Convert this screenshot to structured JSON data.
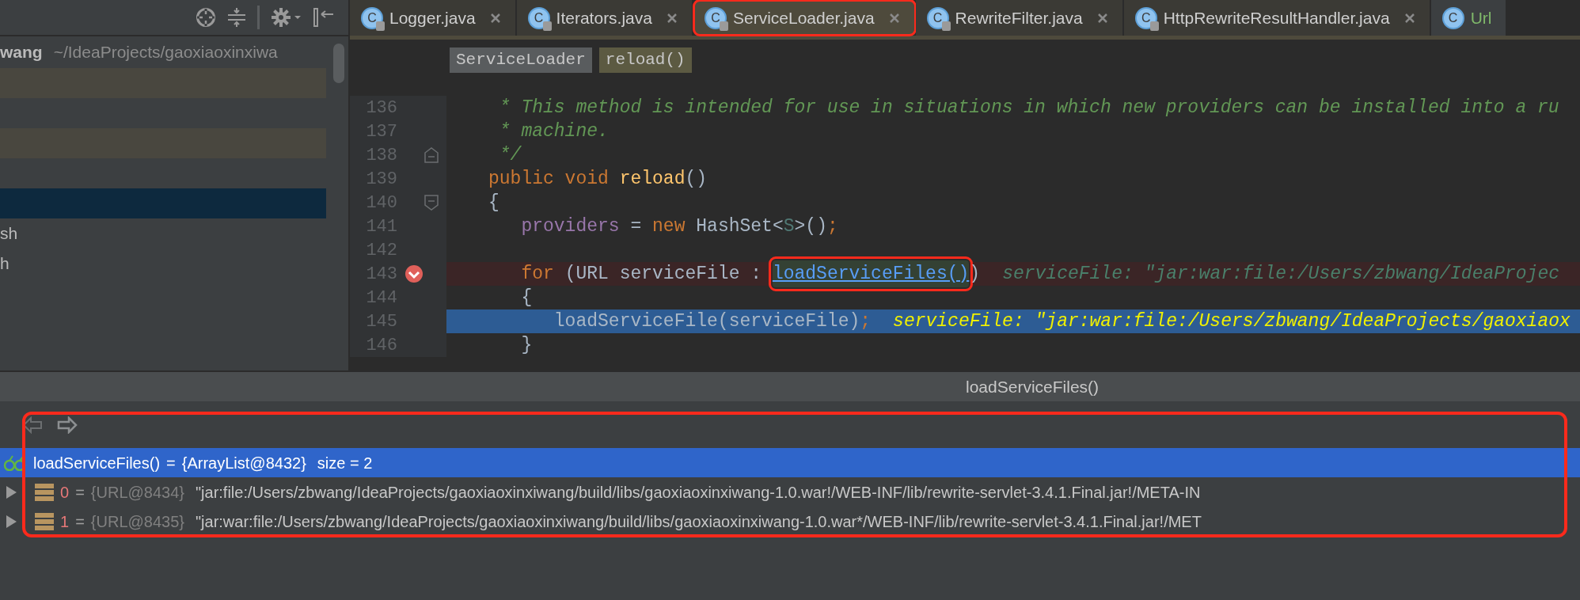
{
  "project_panel": {
    "root": {
      "name": "wang",
      "path": "~/IdeaProjects/gaoxiaoxinxiwa"
    },
    "rows": [
      {
        "highlighted": true,
        "selected": false
      },
      {
        "highlighted": true,
        "selected": false
      },
      {
        "highlighted": false,
        "selected": true
      },
      {
        "label": "sh",
        "highlighted": false,
        "selected": false
      },
      {
        "label": "h",
        "highlighted": false,
        "selected": false
      }
    ]
  },
  "editor_tabs": [
    {
      "label": "Logger.java",
      "icon_letter": "C",
      "selected": false,
      "locked": true,
      "project_file": false,
      "added": false,
      "closable": true
    },
    {
      "label": "Iterators.java",
      "icon_letter": "C",
      "selected": false,
      "locked": true,
      "project_file": false,
      "added": false,
      "closable": true
    },
    {
      "label": "ServiceLoader.java",
      "icon_letter": "C",
      "selected": true,
      "locked": true,
      "project_file": false,
      "added": false,
      "closable": true,
      "annotated": true
    },
    {
      "label": "RewriteFilter.java",
      "icon_letter": "C",
      "selected": false,
      "locked": true,
      "project_file": false,
      "added": false,
      "closable": true
    },
    {
      "label": "HttpRewriteResultHandler.java",
      "icon_letter": "C",
      "selected": false,
      "locked": true,
      "project_file": false,
      "added": false,
      "closable": true
    },
    {
      "label": "Url",
      "icon_letter": "C",
      "selected": false,
      "locked": false,
      "project_file": true,
      "added": true,
      "closable": false
    }
  ],
  "breadcrumbs": [
    {
      "label": "ServiceLoader",
      "kind": "class"
    },
    {
      "label": "reload()",
      "kind": "method"
    }
  ],
  "code_lines": [
    {
      "number": "136",
      "breakpoint": false,
      "execution_point": false,
      "fold_start": false,
      "fold_end": false,
      "tokens": [
        {
          "kind": "comment",
          "text": " * This method is intended for use in situations in which new providers can be installed into a ru"
        }
      ]
    },
    {
      "number": "137",
      "breakpoint": false,
      "execution_point": false,
      "fold_start": false,
      "fold_end": false,
      "tokens": [
        {
          "kind": "comment",
          "text": " * machine."
        }
      ]
    },
    {
      "number": "138",
      "breakpoint": false,
      "execution_point": false,
      "fold_start": false,
      "fold_end": true,
      "tokens": [
        {
          "kind": "comment",
          "text": " */"
        }
      ]
    },
    {
      "number": "139",
      "breakpoint": false,
      "execution_point": false,
      "fold_start": false,
      "fold_end": false,
      "tokens": [
        {
          "kind": "keyword",
          "text": "public void "
        },
        {
          "kind": "method",
          "text": "reload"
        },
        {
          "kind": "plain",
          "text": "()"
        }
      ]
    },
    {
      "number": "140",
      "breakpoint": false,
      "execution_point": false,
      "fold_start": true,
      "fold_end": false,
      "tokens": [
        {
          "kind": "plain",
          "text": "{"
        }
      ]
    },
    {
      "number": "141",
      "breakpoint": false,
      "execution_point": false,
      "fold_start": false,
      "fold_end": false,
      "tokens": [
        {
          "kind": "field",
          "text": "   providers"
        },
        {
          "kind": "plain",
          "text": " = "
        },
        {
          "kind": "keyword",
          "text": "new"
        },
        {
          "kind": "plain",
          "text": " HashSet<"
        },
        {
          "kind": "type_param",
          "text": "S"
        },
        {
          "kind": "plain",
          "text": ">()"
        },
        {
          "kind": "semicolon",
          "text": ";"
        }
      ]
    },
    {
      "number": "142",
      "breakpoint": false,
      "execution_point": false,
      "fold_start": false,
      "fold_end": false
    },
    {
      "number": "143",
      "breakpoint": true,
      "execution_point": false,
      "fold_start": false,
      "fold_end": false,
      "tokens": [
        {
          "kind": "keyword",
          "text": "   for"
        },
        {
          "kind": "plain",
          "text": " (URL serviceFile : "
        },
        {
          "kind": "link",
          "text": "loadServiceFiles()",
          "annotated": true
        },
        {
          "kind": "plain",
          "text": ")"
        },
        {
          "kind": "hint",
          "text": "serviceFile: \"jar:war:file:/Users/zbwang/IdeaProjec"
        }
      ]
    },
    {
      "number": "144",
      "breakpoint": false,
      "execution_point": false,
      "fold_start": false,
      "fold_end": false,
      "tokens": [
        {
          "kind": "plain",
          "text": "   {"
        }
      ]
    },
    {
      "number": "145",
      "breakpoint": false,
      "execution_point": true,
      "fold_start": false,
      "fold_end": false,
      "tokens": [
        {
          "kind": "plain",
          "text": "      loadServiceFile(serviceFile)"
        },
        {
          "kind": "semicolon",
          "text": ";"
        },
        {
          "kind": "current_hint",
          "text": "serviceFile: \"jar:war:file:/Users/zbwang/IdeaProjects/gaoxiaox"
        }
      ]
    },
    {
      "number": "146",
      "breakpoint": false,
      "execution_point": false,
      "fold_start": false,
      "fold_end": false,
      "tokens": [
        {
          "kind": "plain",
          "text": "   }"
        }
      ]
    }
  ],
  "evaluate_panel": {
    "title": "loadServiceFiles()",
    "annotated": true,
    "variables": [
      {
        "kind": "watch",
        "name": "loadServiceFiles()",
        "separator": "=",
        "type_ref": "{ArrayList@8432}",
        "value": "size = 2",
        "selected": true
      },
      {
        "kind": "field",
        "name": "0",
        "separator": "=",
        "type_ref": "{URL@8434}",
        "value": "\"jar:file:/Users/zbwang/IdeaProjects/gaoxiaoxinxiwang/build/libs/gaoxiaoxinxiwang-1.0.war!/WEB-INF/lib/rewrite-servlet-3.4.1.Final.jar!/META-IN",
        "selected": false
      },
      {
        "kind": "field",
        "name": "1",
        "separator": "=",
        "type_ref": "{URL@8435}",
        "value": "\"jar:war:file:/Users/zbwang/IdeaProjects/gaoxiaoxinxiwang/build/libs/gaoxiaoxinxiwang-1.0.war*/WEB-INF/lib/rewrite-servlet-3.4.1.Final.jar!/MET",
        "selected": false
      }
    ]
  }
}
